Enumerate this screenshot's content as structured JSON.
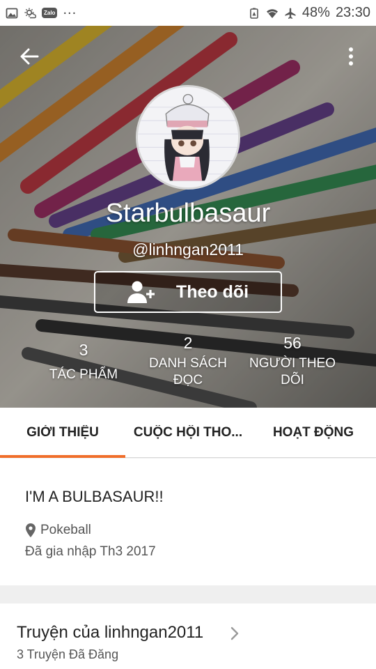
{
  "status_bar": {
    "zalo_label": "Zalo",
    "more": "...",
    "battery": "48%",
    "time": "23:30"
  },
  "header": {
    "display_name": "Starbulbasaur",
    "username": "@linhngan2011",
    "follow_label": "Theo dõi"
  },
  "stats": [
    {
      "value": "3",
      "label": "TÁC PHẨM"
    },
    {
      "value": "2",
      "label": "DANH SÁCH ĐỌC"
    },
    {
      "value": "56",
      "label": "NGƯỜI THEO DÕI"
    }
  ],
  "tabs": [
    {
      "label": "GIỚI THIỆU",
      "active": true
    },
    {
      "label": "CUỘC HỘI THO...",
      "active": false
    },
    {
      "label": "HOẠT ĐỘNG",
      "active": false
    }
  ],
  "about": {
    "bio": "I'M A BULBASAUR!!",
    "location": "Pokeball",
    "joined": "Đã gia nhập Th3 2017"
  },
  "stories": {
    "title": "Truyện của linhngan2011",
    "subtitle": "3 Truyện Đã Đăng"
  },
  "colors": {
    "accent": "#f06e2a",
    "tab_text": "#222222",
    "divider": "#efefef"
  },
  "icons": {
    "status_left": [
      "gallery-icon",
      "weather-icon",
      "zalo-icon"
    ],
    "status_right": [
      "battery-saver-icon",
      "wifi-icon",
      "airplane-icon"
    ],
    "header": [
      "back-arrow-icon",
      "more-vertical-icon",
      "add-user-icon"
    ],
    "about": [
      "location-pin-icon"
    ],
    "stories": [
      "chevron-right-icon"
    ]
  }
}
